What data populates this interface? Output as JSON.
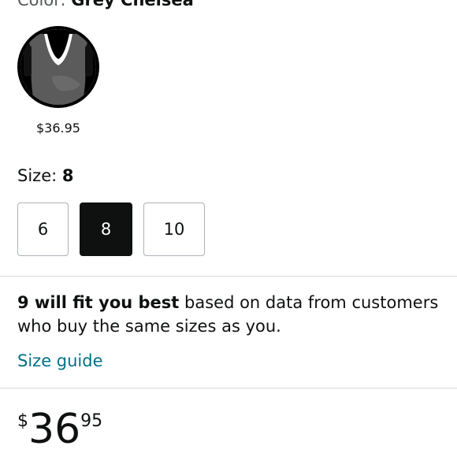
{
  "color": {
    "label": "Color: ",
    "value": "Grey Chelsea"
  },
  "swatch": {
    "price": "$36.95"
  },
  "size": {
    "label": "Size: ",
    "value": "8",
    "options": [
      "6",
      "8",
      "10"
    ],
    "selected": "8"
  },
  "fit": {
    "bold": "9 will fit you best",
    "rest": " based on data from customers who buy the same sizes as you."
  },
  "size_guide": "Size guide",
  "price": {
    "symbol": "$",
    "whole": "36",
    "fraction": "95"
  },
  "colors": {
    "link": "#007185",
    "selected_bg": "#0f1111",
    "border": "#adb1b8"
  }
}
